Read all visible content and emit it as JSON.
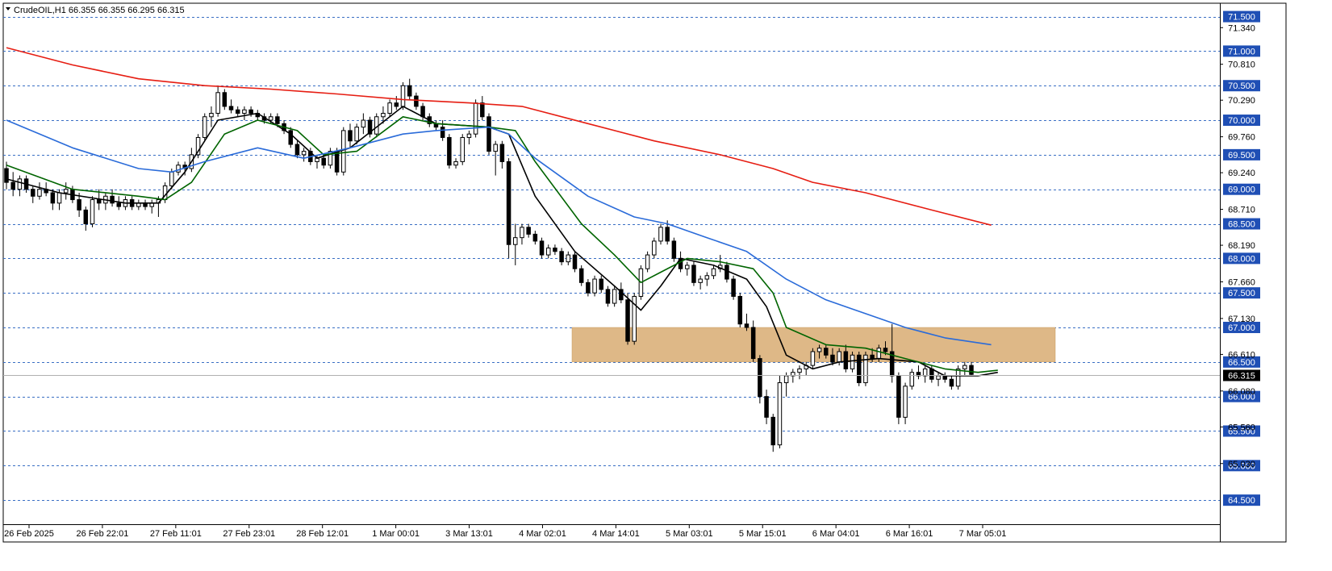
{
  "header": {
    "symbol_line": "CrudeOIL,H1  66.355 66.355 66.295 66.315"
  },
  "colors": {
    "background": "#ffffff",
    "grid_line": "#3a6fc4",
    "axis_badge": "#1f4fb5",
    "last_price_badge": "#000000",
    "zone_fill": "#deb887",
    "ma_fast": "#000000",
    "ma_mid": "#006400",
    "ma_slow": "#2a6bd9",
    "ma_long": "#e61d12",
    "candle_up": "#ffffff",
    "candle_down": "#000000"
  },
  "chart_data": {
    "type": "candlestick",
    "title": "CrudeOIL,H1",
    "timeframe": "H1",
    "ylim": [
      64.35,
      71.6
    ],
    "grid": true,
    "y_levels": [
      71.5,
      71.0,
      70.5,
      70.0,
      69.5,
      69.0,
      68.5,
      68.0,
      67.5,
      67.0,
      66.5,
      66.0,
      65.5,
      65.0,
      64.5
    ],
    "y_ticks_plain": [
      71.34,
      70.81,
      70.29,
      69.76,
      69.24,
      68.71,
      68.19,
      67.66,
      67.13,
      66.61,
      66.08,
      65.56,
      65.03
    ],
    "y_tick_labels": [
      "71.500",
      "71.340",
      "71.000",
      "70.810",
      "70.500",
      "70.290",
      "70.000",
      "69.760",
      "69.500",
      "69.240",
      "69.000",
      "68.710",
      "68.500",
      "68.190",
      "68.000",
      "67.660",
      "67.500",
      "67.130",
      "67.000",
      "66.610",
      "66.500",
      "66.080",
      "66.000",
      "65.560",
      "65.500",
      "65.030",
      "65.000",
      "64.500"
    ],
    "last_price": 66.315,
    "last_price_label": "66.315",
    "x_tick_labels": [
      "26 Feb 2025",
      "26 Feb 22:01",
      "27 Feb 11:01",
      "27 Feb 23:01",
      "28 Feb 12:01",
      "1 Mar 00:01",
      "3 Mar 13:01",
      "4 Mar 02:01",
      "4 Mar 14:01",
      "5 Mar 03:01",
      "5 Mar 15:01",
      "6 Mar 04:01",
      "6 Mar 16:01",
      "7 Mar 05:01"
    ],
    "zone": {
      "from": 66.5,
      "to": 67.0,
      "start_date": "4 Mar 12:01",
      "end": "right"
    },
    "candles": [
      [
        69.3,
        69.4,
        69.0,
        69.1
      ],
      [
        69.1,
        69.25,
        68.9,
        69.0
      ],
      [
        69.0,
        69.2,
        68.9,
        69.15
      ],
      [
        69.15,
        69.2,
        68.95,
        69.0
      ],
      [
        69.0,
        69.05,
        68.8,
        68.9
      ],
      [
        68.9,
        69.1,
        68.85,
        69.0
      ],
      [
        69.0,
        69.1,
        68.9,
        68.95
      ],
      [
        68.95,
        69.0,
        68.7,
        68.8
      ],
      [
        68.8,
        69.0,
        68.7,
        68.95
      ],
      [
        68.95,
        69.1,
        68.85,
        69.0
      ],
      [
        69.0,
        69.05,
        68.8,
        68.85
      ],
      [
        68.85,
        68.95,
        68.6,
        68.7
      ],
      [
        68.7,
        68.75,
        68.4,
        68.5
      ],
      [
        68.5,
        68.9,
        68.45,
        68.85
      ],
      [
        68.85,
        69.0,
        68.7,
        68.8
      ],
      [
        68.8,
        68.95,
        68.7,
        68.9
      ],
      [
        68.9,
        69.0,
        68.75,
        68.8
      ],
      [
        68.8,
        68.9,
        68.7,
        68.75
      ],
      [
        68.75,
        68.9,
        68.7,
        68.85
      ],
      [
        68.85,
        68.9,
        68.7,
        68.75
      ],
      [
        68.75,
        68.85,
        68.7,
        68.8
      ],
      [
        68.8,
        68.85,
        68.7,
        68.75
      ],
      [
        68.75,
        68.85,
        68.65,
        68.8
      ],
      [
        68.8,
        68.9,
        68.6,
        68.85
      ],
      [
        68.85,
        69.1,
        68.8,
        69.05
      ],
      [
        69.05,
        69.3,
        69.0,
        69.25
      ],
      [
        69.25,
        69.4,
        69.2,
        69.35
      ],
      [
        69.35,
        69.4,
        69.2,
        69.3
      ],
      [
        69.3,
        69.6,
        69.25,
        69.5
      ],
      [
        69.5,
        69.8,
        69.45,
        69.75
      ],
      [
        69.75,
        70.1,
        69.7,
        70.05
      ],
      [
        70.05,
        70.2,
        69.9,
        70.1
      ],
      [
        70.1,
        70.5,
        70.05,
        70.4
      ],
      [
        70.4,
        70.45,
        70.15,
        70.2
      ],
      [
        70.2,
        70.3,
        70.1,
        70.15
      ],
      [
        70.15,
        70.2,
        70.05,
        70.1
      ],
      [
        70.1,
        70.2,
        70.0,
        70.15
      ],
      [
        70.15,
        70.2,
        70.05,
        70.1
      ],
      [
        70.1,
        70.15,
        70.0,
        70.05
      ],
      [
        70.05,
        70.1,
        69.95,
        70.0
      ],
      [
        70.0,
        70.1,
        69.95,
        70.05
      ],
      [
        70.05,
        70.1,
        69.9,
        69.95
      ],
      [
        69.95,
        70.0,
        69.8,
        69.85
      ],
      [
        69.85,
        69.9,
        69.6,
        69.65
      ],
      [
        69.65,
        69.7,
        69.45,
        69.5
      ],
      [
        69.5,
        69.6,
        69.4,
        69.55
      ],
      [
        69.55,
        69.6,
        69.35,
        69.4
      ],
      [
        69.4,
        69.5,
        69.3,
        69.45
      ],
      [
        69.45,
        69.5,
        69.3,
        69.35
      ],
      [
        69.35,
        69.6,
        69.3,
        69.55
      ],
      [
        69.55,
        69.6,
        69.2,
        69.25
      ],
      [
        69.25,
        69.9,
        69.2,
        69.85
      ],
      [
        69.85,
        69.95,
        69.6,
        69.7
      ],
      [
        69.7,
        69.95,
        69.65,
        69.9
      ],
      [
        69.9,
        70.1,
        69.8,
        70.0
      ],
      [
        70.0,
        70.05,
        69.75,
        69.8
      ],
      [
        69.8,
        70.1,
        69.75,
        70.05
      ],
      [
        70.05,
        70.2,
        69.95,
        70.1
      ],
      [
        70.1,
        70.3,
        70.05,
        70.25
      ],
      [
        70.25,
        70.35,
        70.15,
        70.2
      ],
      [
        70.2,
        70.55,
        70.15,
        70.5
      ],
      [
        70.5,
        70.6,
        70.3,
        70.35
      ],
      [
        70.35,
        70.4,
        70.15,
        70.2
      ],
      [
        70.2,
        70.25,
        70.0,
        70.05
      ],
      [
        70.05,
        70.1,
        69.9,
        69.95
      ],
      [
        69.95,
        70.0,
        69.85,
        69.9
      ],
      [
        69.9,
        70.0,
        69.7,
        69.75
      ],
      [
        69.75,
        69.8,
        69.3,
        69.35
      ],
      [
        69.35,
        69.45,
        69.3,
        69.4
      ],
      [
        69.4,
        69.8,
        69.35,
        69.75
      ],
      [
        69.75,
        69.85,
        69.65,
        69.8
      ],
      [
        69.8,
        70.3,
        69.75,
        70.25
      ],
      [
        70.25,
        70.35,
        70.0,
        70.05
      ],
      [
        70.05,
        70.1,
        69.5,
        69.55
      ],
      [
        69.55,
        69.7,
        69.2,
        69.65
      ],
      [
        69.65,
        69.7,
        69.3,
        69.4
      ],
      [
        69.4,
        69.45,
        68.0,
        68.2
      ],
      [
        68.2,
        68.5,
        67.9,
        68.3
      ],
      [
        68.3,
        68.5,
        68.2,
        68.45
      ],
      [
        68.45,
        68.5,
        68.3,
        68.35
      ],
      [
        68.35,
        68.4,
        68.2,
        68.25
      ],
      [
        68.25,
        68.3,
        68.0,
        68.05
      ],
      [
        68.05,
        68.2,
        68.0,
        68.15
      ],
      [
        68.15,
        68.2,
        68.05,
        68.1
      ],
      [
        68.1,
        68.15,
        67.9,
        67.95
      ],
      [
        67.95,
        68.1,
        67.9,
        68.05
      ],
      [
        68.05,
        68.1,
        67.8,
        67.85
      ],
      [
        67.85,
        67.9,
        67.6,
        67.65
      ],
      [
        67.65,
        67.7,
        67.45,
        67.5
      ],
      [
        67.5,
        67.75,
        67.45,
        67.7
      ],
      [
        67.7,
        67.75,
        67.5,
        67.55
      ],
      [
        67.55,
        67.6,
        67.3,
        67.35
      ],
      [
        67.35,
        67.6,
        67.3,
        67.55
      ],
      [
        67.55,
        67.65,
        67.35,
        67.4
      ],
      [
        67.4,
        67.5,
        66.75,
        66.8
      ],
      [
        66.8,
        67.5,
        66.75,
        67.45
      ],
      [
        67.45,
        67.9,
        67.4,
        67.85
      ],
      [
        67.85,
        68.1,
        67.8,
        68.05
      ],
      [
        68.05,
        68.3,
        68.0,
        68.25
      ],
      [
        68.25,
        68.5,
        68.2,
        68.45
      ],
      [
        68.45,
        68.55,
        68.2,
        68.25
      ],
      [
        68.25,
        68.3,
        67.95,
        68.0
      ],
      [
        68.0,
        68.1,
        67.8,
        67.85
      ],
      [
        67.85,
        67.95,
        67.75,
        67.9
      ],
      [
        67.9,
        67.95,
        67.6,
        67.65
      ],
      [
        67.65,
        67.75,
        67.55,
        67.7
      ],
      [
        67.7,
        67.8,
        67.6,
        67.75
      ],
      [
        67.75,
        67.9,
        67.7,
        67.85
      ],
      [
        67.85,
        68.05,
        67.8,
        67.9
      ],
      [
        67.9,
        67.95,
        67.65,
        67.7
      ],
      [
        67.7,
        67.75,
        67.4,
        67.45
      ],
      [
        67.45,
        67.5,
        67.0,
        67.05
      ],
      [
        67.05,
        67.2,
        66.95,
        67.0
      ],
      [
        67.0,
        67.1,
        66.5,
        66.55
      ],
      [
        66.55,
        66.6,
        65.9,
        66.0
      ],
      [
        66.0,
        66.1,
        65.6,
        65.7
      ],
      [
        65.7,
        65.75,
        65.2,
        65.3
      ],
      [
        65.3,
        66.3,
        65.25,
        66.2
      ],
      [
        66.2,
        66.35,
        66.0,
        66.3
      ],
      [
        66.3,
        66.4,
        66.2,
        66.35
      ],
      [
        66.35,
        66.45,
        66.25,
        66.4
      ],
      [
        66.4,
        66.5,
        66.3,
        66.45
      ],
      [
        66.45,
        66.7,
        66.4,
        66.65
      ],
      [
        66.65,
        66.75,
        66.55,
        66.7
      ],
      [
        66.7,
        66.75,
        66.55,
        66.6
      ],
      [
        66.6,
        66.7,
        66.45,
        66.5
      ],
      [
        66.5,
        66.7,
        66.45,
        66.65
      ],
      [
        66.65,
        66.75,
        66.35,
        66.4
      ],
      [
        66.4,
        66.65,
        66.35,
        66.6
      ],
      [
        66.6,
        66.65,
        66.15,
        66.2
      ],
      [
        66.2,
        66.65,
        66.15,
        66.6
      ],
      [
        66.6,
        66.7,
        66.5,
        66.55
      ],
      [
        66.55,
        66.75,
        66.5,
        66.7
      ],
      [
        66.7,
        66.8,
        66.6,
        66.65
      ],
      [
        66.65,
        67.05,
        66.2,
        66.3
      ],
      [
        66.3,
        66.35,
        65.6,
        65.7
      ],
      [
        65.7,
        66.2,
        65.6,
        66.15
      ],
      [
        66.15,
        66.4,
        66.1,
        66.35
      ],
      [
        66.35,
        66.45,
        66.25,
        66.3
      ],
      [
        66.3,
        66.45,
        66.2,
        66.4
      ],
      [
        66.4,
        66.45,
        66.2,
        66.25
      ],
      [
        66.25,
        66.35,
        66.15,
        66.3
      ],
      [
        66.3,
        66.35,
        66.2,
        66.25
      ],
      [
        66.25,
        66.3,
        66.1,
        66.15
      ],
      [
        66.15,
        66.45,
        66.1,
        66.4
      ],
      [
        66.4,
        66.5,
        66.3,
        66.45
      ],
      [
        66.45,
        66.5,
        66.3,
        66.32
      ]
    ],
    "series": [
      {
        "kind": "ma_fast",
        "values": [
          [
            0,
            69.15
          ],
          [
            8,
            68.95
          ],
          [
            18,
            68.8
          ],
          [
            23,
            68.8
          ],
          [
            27,
            69.25
          ],
          [
            32,
            70.0
          ],
          [
            38,
            70.1
          ],
          [
            43,
            69.8
          ],
          [
            47,
            69.45
          ],
          [
            52,
            69.6
          ],
          [
            60,
            70.2
          ],
          [
            65,
            69.95
          ],
          [
            73,
            69.9
          ],
          [
            76,
            69.8
          ],
          [
            80,
            68.9
          ],
          [
            86,
            68.1
          ],
          [
            92,
            67.6
          ],
          [
            96,
            67.25
          ],
          [
            99,
            67.6
          ],
          [
            102,
            68.0
          ],
          [
            107,
            67.9
          ],
          [
            112,
            67.7
          ],
          [
            115,
            67.3
          ],
          [
            118,
            66.6
          ],
          [
            122,
            66.4
          ],
          [
            126,
            66.5
          ],
          [
            132,
            66.55
          ],
          [
            138,
            66.5
          ],
          [
            142,
            66.3
          ],
          [
            147,
            66.3
          ],
          [
            150,
            66.35
          ]
        ]
      },
      {
        "kind": "ma_mid",
        "values": [
          [
            0,
            69.35
          ],
          [
            10,
            69.0
          ],
          [
            20,
            68.9
          ],
          [
            24,
            68.85
          ],
          [
            28,
            69.1
          ],
          [
            33,
            69.8
          ],
          [
            38,
            70.0
          ],
          [
            44,
            69.85
          ],
          [
            48,
            69.5
          ],
          [
            53,
            69.55
          ],
          [
            60,
            70.05
          ],
          [
            65,
            69.95
          ],
          [
            73,
            69.9
          ],
          [
            77,
            69.85
          ],
          [
            80,
            69.4
          ],
          [
            87,
            68.5
          ],
          [
            92,
            68.05
          ],
          [
            96,
            67.65
          ],
          [
            99,
            67.8
          ],
          [
            103,
            68.0
          ],
          [
            108,
            67.95
          ],
          [
            113,
            67.85
          ],
          [
            116,
            67.5
          ],
          [
            118,
            67.0
          ],
          [
            124,
            66.75
          ],
          [
            130,
            66.7
          ],
          [
            136,
            66.55
          ],
          [
            142,
            66.4
          ],
          [
            147,
            66.35
          ],
          [
            150,
            66.38
          ]
        ]
      },
      {
        "kind": "ma_slow",
        "values": [
          [
            0,
            70.0
          ],
          [
            10,
            69.6
          ],
          [
            20,
            69.3
          ],
          [
            25,
            69.25
          ],
          [
            30,
            69.4
          ],
          [
            38,
            69.6
          ],
          [
            45,
            69.45
          ],
          [
            52,
            69.6
          ],
          [
            60,
            69.8
          ],
          [
            65,
            69.85
          ],
          [
            73,
            69.9
          ],
          [
            76,
            69.8
          ],
          [
            80,
            69.45
          ],
          [
            88,
            68.9
          ],
          [
            95,
            68.6
          ],
          [
            100,
            68.5
          ],
          [
            106,
            68.3
          ],
          [
            112,
            68.1
          ],
          [
            118,
            67.7
          ],
          [
            124,
            67.4
          ],
          [
            130,
            67.2
          ],
          [
            136,
            67.0
          ],
          [
            142,
            66.85
          ],
          [
            149,
            66.75
          ]
        ]
      },
      {
        "kind": "ma_long",
        "values": [
          [
            0,
            71.05
          ],
          [
            10,
            70.8
          ],
          [
            20,
            70.6
          ],
          [
            30,
            70.5
          ],
          [
            40,
            70.45
          ],
          [
            50,
            70.38
          ],
          [
            60,
            70.3
          ],
          [
            70,
            70.25
          ],
          [
            78,
            70.2
          ],
          [
            88,
            69.95
          ],
          [
            98,
            69.7
          ],
          [
            108,
            69.5
          ],
          [
            116,
            69.3
          ],
          [
            122,
            69.1
          ],
          [
            130,
            68.95
          ],
          [
            140,
            68.7
          ],
          [
            149,
            68.48
          ]
        ]
      }
    ]
  }
}
